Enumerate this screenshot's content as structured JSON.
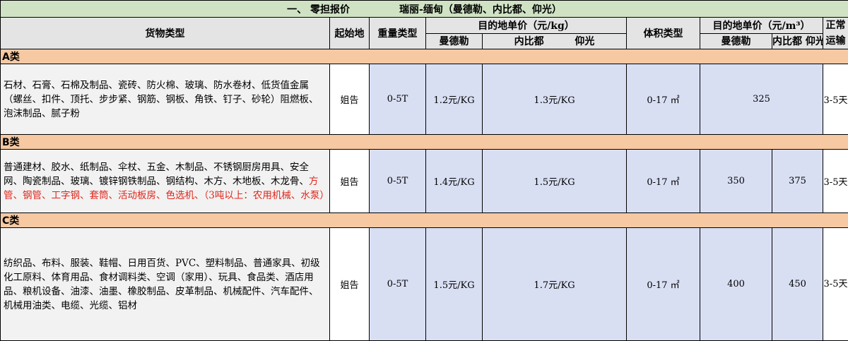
{
  "title": {
    "section": "一、  零担报价",
    "route": "瑞丽-缅甸（曼德勒、内比都、仰光）"
  },
  "headers": {
    "cargo_type": "货物类型",
    "origin": "起始地",
    "weight_type": "重量类型",
    "weight_price_group": "目的地单价（元/kg）",
    "volume_type": "体积类型",
    "volume_price_group": "目的地单价（元/m³）",
    "transit": "正常运输",
    "city1": "曼德勒",
    "city2": "内比都",
    "city3": "仰光"
  },
  "categories": [
    {
      "label": "A类",
      "desc": "石材、石膏、石棉及制品、瓷砖、防火棉、玻璃、防水卷材、低货值金属（螺丝、扣件、顶托、步步紧、钢筋、钢板、角铁、钉子、砂轮）阻燃板、泡沫制品、腻子粉",
      "desc_red": "",
      "origin": "姐告",
      "weight_type": "0-5T",
      "price_kg_mandalay": "1.2元/KG",
      "price_kg_other": "1.3元/KG",
      "volume_type": "0-17 ㎡",
      "price_m3_all": "325",
      "transit": "3-5天"
    },
    {
      "label": "B类",
      "desc": "普通建材、胶水、纸制品、伞杖、五金、木制品、不锈钢厨房用具、安全网、陶瓷制品、玻璃、镀锌钢铁制品、钢结构、木方、木地板、木龙骨、",
      "desc_red": "方管、钢管、工字钢、套筒、活动板房、色选机、（3吨以上：农用机械、水泵）",
      "origin": "姐告",
      "weight_type": "0-5T",
      "price_kg_mandalay": "1.4元/KG",
      "price_kg_other": "1.5元/KG",
      "volume_type": "0-17 ㎡",
      "price_m3_mandalay": "350",
      "price_m3_other": "375",
      "transit": "3-5天"
    },
    {
      "label": "C类",
      "desc": "纺织品、布料、服装、鞋帽、日用百货、PVC、塑料制品、普通家具、初级化工原料、体育用品、食材调料类、空调（家用）、玩具、食品类、酒店用品、粮机设备、油漆、油墨、橡胶制品、皮革制品、机械配件、汽车配件、机械用油类、电缆、光缆、铝材",
      "desc_red": "",
      "origin": "姐告",
      "weight_type": "0-5T",
      "price_kg_mandalay": "1.5元/KG",
      "price_kg_other": "1.7元/KG",
      "volume_type": "0-17 ㎡",
      "price_m3_mandalay": "400",
      "price_m3_other": "450",
      "transit": "3-5天"
    }
  ]
}
